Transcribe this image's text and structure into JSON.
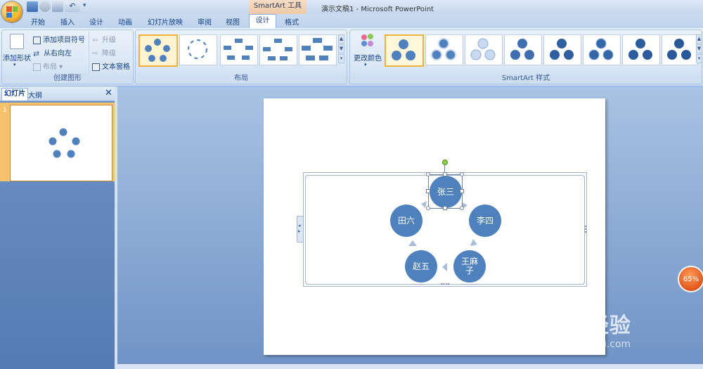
{
  "titlebar": {
    "context_tools": "SmartArt 工具",
    "window_title": "演示文稿1 - Microsoft PowerPoint",
    "qat_more": "▾"
  },
  "tabs": [
    "开始",
    "插入",
    "设计",
    "动画",
    "幻灯片放映",
    "审阅",
    "视图"
  ],
  "context_tabs": {
    "design": "设计",
    "format": "格式"
  },
  "groups": {
    "create_graphic": {
      "label": "创建图形",
      "add_shape": "添加形状",
      "add_bullet": "添加项目符号",
      "right_to_left": "从右向左",
      "layout": "布局",
      "promote": "升级",
      "demote": "降级",
      "text_pane": "文本窗格"
    },
    "layouts": {
      "label": "布局"
    },
    "smartart_styles": {
      "label": "SmartArt 样式",
      "change_colors": "更改颜色"
    }
  },
  "left_pane": {
    "tab_slides": "幻灯片",
    "tab_outline": "大纲",
    "close": "✕",
    "slide_number": "1"
  },
  "diagram": {
    "nodes": [
      "张三",
      "李四",
      "王麻子",
      "赵五",
      "田六"
    ]
  },
  "zoom": "65%",
  "watermark": {
    "logo": "Bai 经验",
    "url": "jingyan.baidu.com"
  },
  "colors": {
    "node": "#4f81bd",
    "arrow": "#a8bcd8",
    "accent": "#f1b23c"
  }
}
